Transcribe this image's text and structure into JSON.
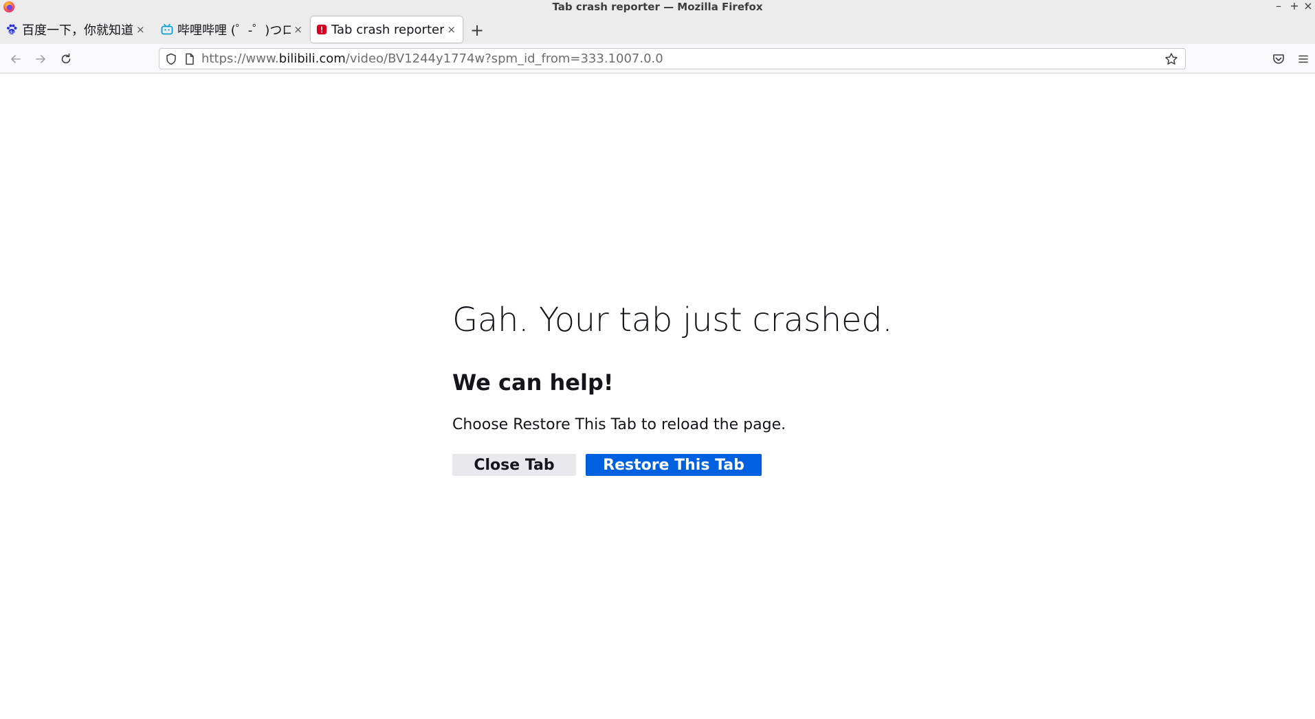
{
  "window": {
    "title": "Tab crash reporter — Mozilla Firefox",
    "minimize": "–",
    "maximize": "+",
    "close": "×"
  },
  "tabs": [
    {
      "label": "百度一下，你就知道",
      "close": "×",
      "icon": "baidu-paw-icon",
      "active": false
    },
    {
      "label": "哔哩哔哩 (゜-゜)つロ",
      "close": "×",
      "icon": "bilibili-tv-icon",
      "active": false
    },
    {
      "label": "Tab crash reporter",
      "close": "×",
      "icon": "crash-warning-icon",
      "active": true
    }
  ],
  "newtab_label": "+",
  "urlbar": {
    "scheme": "https://www.",
    "host": "bilibili.com",
    "path": "/video/BV1244y1774w?spm_id_from=333.1007.0.0"
  },
  "crash_page": {
    "heading": "Gah. Your tab just crashed.",
    "subheading": "We can help!",
    "message": "Choose Restore This Tab to reload the page.",
    "close_button": "Close Tab",
    "restore_button": "Restore This Tab"
  },
  "colors": {
    "primary_button": "#0061e0",
    "secondary_button": "#e9e9ed",
    "crash_icon": "#d70022"
  }
}
